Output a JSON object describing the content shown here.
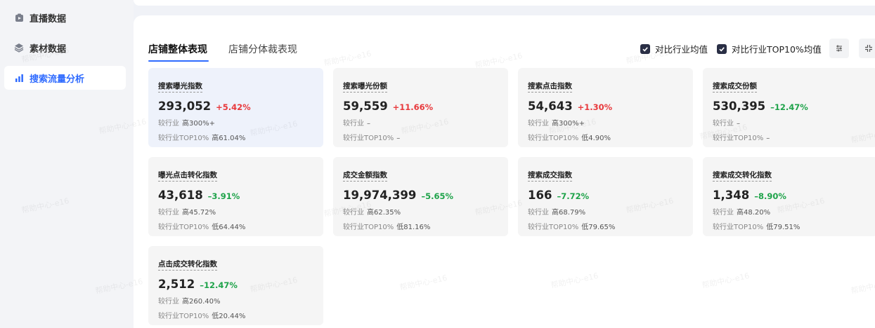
{
  "sidebar": {
    "items": [
      {
        "label": "直播数据",
        "icon": "video-icon"
      },
      {
        "label": "素材数据",
        "icon": "layers-icon"
      },
      {
        "label": "搜索流量分析",
        "icon": "bar-chart-icon",
        "active": true
      }
    ]
  },
  "tabs": [
    {
      "label": "店铺整体表现",
      "active": true
    },
    {
      "label": "店铺分体裁表现",
      "active": false
    }
  ],
  "toolbar": {
    "compare_industry_avg": "对比行业均值",
    "compare_top10_avg": "对比行业TOP10%均值"
  },
  "cards": [
    {
      "title": "搜索曝光指数",
      "value": "293,052",
      "change": "+5.42%",
      "direction": "up",
      "industry_label": "较行业",
      "industry_value": "高300%+",
      "top10_label": "较行业TOP10%",
      "top10_value": "高61.04%"
    },
    {
      "title": "搜索曝光份额",
      "value": "59,559",
      "change": "+11.66%",
      "direction": "up",
      "industry_label": "较行业",
      "industry_value": "–",
      "top10_label": "较行业TOP10%",
      "top10_value": "–"
    },
    {
      "title": "搜索点击指数",
      "value": "54,643",
      "change": "+1.30%",
      "direction": "up",
      "industry_label": "较行业",
      "industry_value": "高300%+",
      "top10_label": "较行业TOP10%",
      "top10_value": "低4.90%"
    },
    {
      "title": "搜索成交份额",
      "value": "530,395",
      "change": "–12.47%",
      "direction": "down",
      "industry_label": "较行业",
      "industry_value": "–",
      "top10_label": "较行业TOP10%",
      "top10_value": "–"
    },
    {
      "title": "曝光点击转化指数",
      "value": "43,618",
      "change": "–3.91%",
      "direction": "down",
      "industry_label": "较行业",
      "industry_value": "高45.72%",
      "top10_label": "较行业TOP10%",
      "top10_value": "低64.44%"
    },
    {
      "title": "成交金额指数",
      "value": "19,974,399",
      "change": "–5.65%",
      "direction": "down",
      "industry_label": "较行业",
      "industry_value": "高62.35%",
      "top10_label": "较行业TOP10%",
      "top10_value": "低81.16%"
    },
    {
      "title": "搜索成交指数",
      "value": "166",
      "change": "–7.72%",
      "direction": "down",
      "industry_label": "较行业",
      "industry_value": "高68.79%",
      "top10_label": "较行业TOP10%",
      "top10_value": "低79.65%"
    },
    {
      "title": "搜索成交转化指数",
      "value": "1,348",
      "change": "–8.90%",
      "direction": "down",
      "industry_label": "较行业",
      "industry_value": "高48.20%",
      "top10_label": "较行业TOP10%",
      "top10_value": "低79.51%"
    },
    {
      "title": "点击成交转化指数",
      "value": "2,512",
      "change": "–12.47%",
      "direction": "down",
      "industry_label": "较行业",
      "industry_value": "高260.40%",
      "top10_label": "较行业TOP10%",
      "top10_value": "低20.44%"
    }
  ],
  "watermark_text": "帮助中心-e16",
  "colors": {
    "accent": "#2f6bff",
    "up": "#e8393c",
    "down": "#1fa34a",
    "checkbox": "#2a2f45",
    "selected_card": "#eef2fb"
  }
}
